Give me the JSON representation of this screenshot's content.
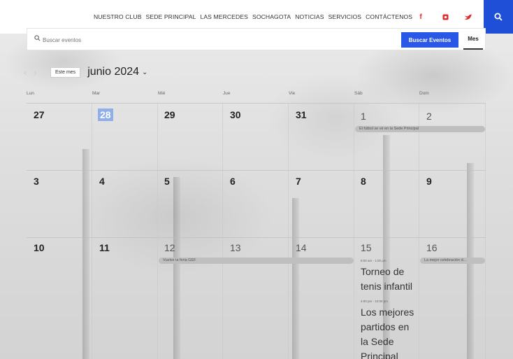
{
  "nav": {
    "links": [
      "NUESTRO CLUB",
      "SEDE PRINCIPAL",
      "LAS MERCEDES",
      "SOCHAGOTA",
      "NOTICIAS",
      "SERVICIOS",
      "CONTÁCTENOS"
    ],
    "social": [
      "f",
      "▣",
      "♥"
    ],
    "search_icon": "search-icon",
    "accent": "#1e4fd6",
    "social_colors": [
      "#e02b2b",
      "#e02b2b",
      "#e02b2b"
    ]
  },
  "toolbar": {
    "search_placeholder": "Buscar eventos",
    "find_button": "Buscar Eventos",
    "view_label": "Mes"
  },
  "calendar": {
    "today_button": "Este mes",
    "month_title": "junio 2024",
    "weekdays": [
      "Lun",
      "Mar",
      "Mié",
      "Jue",
      "Vie",
      "Sáb",
      "Dom"
    ],
    "weeks": [
      [
        "27",
        "28",
        "29",
        "30",
        "31",
        "1",
        "2"
      ],
      [
        "3",
        "4",
        "5",
        "6",
        "7",
        "8",
        "9"
      ],
      [
        "10",
        "11",
        "12",
        "13",
        "14",
        "15",
        "16"
      ]
    ],
    "today": "28",
    "events": {
      "ev1": "El fútbol se vé en la Sede Principal",
      "ev2": "Vuelve la feria GEF",
      "ev3": "La mejor celebración d...",
      "ev4_time": "8:00 am - 1:00 pm",
      "ev4_title": "Torneo de tenis infantil",
      "ev5_time": "4:00 pm - 10:00 pm",
      "ev5_title": "Los mejores partidos en la Sede Principal"
    }
  }
}
